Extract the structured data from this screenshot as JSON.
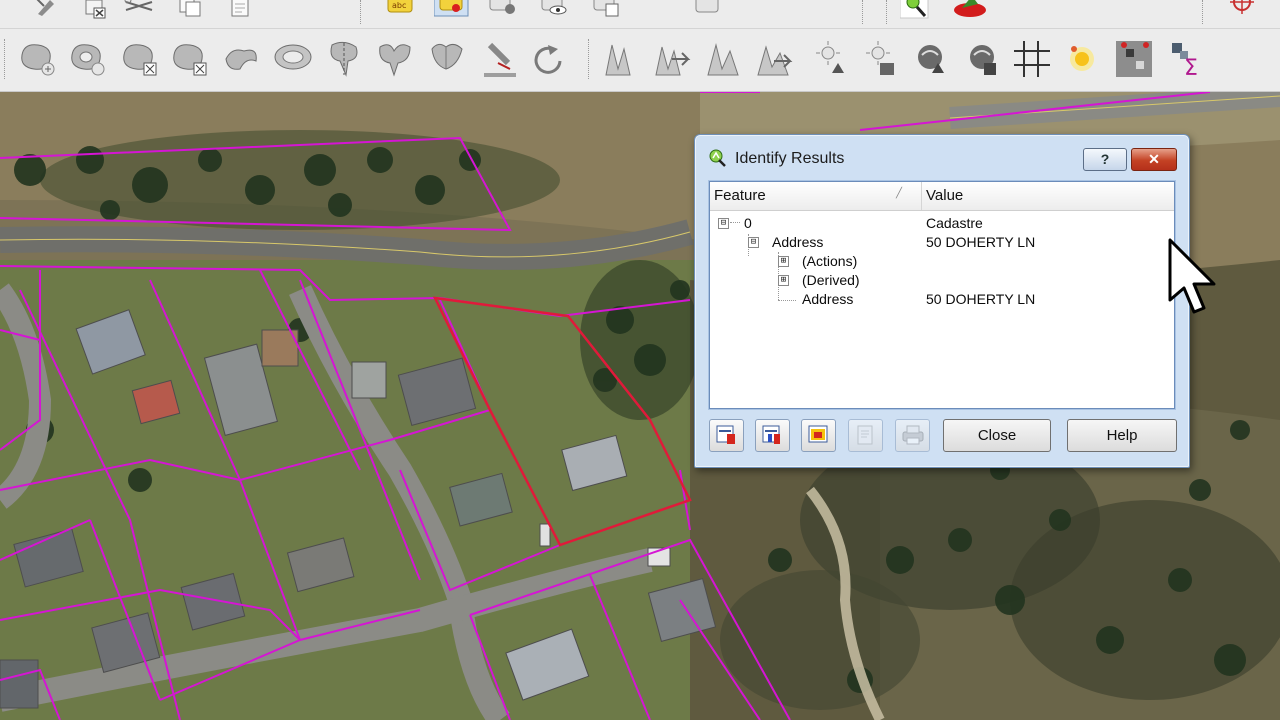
{
  "dialog": {
    "title": "Identify Results",
    "title_help_glyph": "?",
    "title_close_glyph": "✕",
    "columns": {
      "feature": "Feature",
      "value": "Value"
    },
    "rows": [
      {
        "feature": "0",
        "value": "Cadastre",
        "expander": "⊟"
      },
      {
        "feature": "Address",
        "value": "50 DOHERTY LN",
        "expander": "⊟"
      },
      {
        "feature": "(Actions)",
        "value": "",
        "expander": "⊞"
      },
      {
        "feature": "(Derived)",
        "value": "",
        "expander": "⊞"
      },
      {
        "feature": "Address",
        "value": "50 DOHERTY LN",
        "expander": ""
      }
    ],
    "buttons": {
      "close": "Close",
      "help": "Help"
    },
    "icons": [
      "expand-new-feature-icon",
      "expand-all-icon",
      "copy-attributes-icon",
      "copy-icon",
      "print-icon"
    ]
  },
  "toolbar": {
    "top_icons": [
      "edit-pencil-icon",
      "delete-selected-icon",
      "cut-icon",
      "copy-feature-icon",
      "paste-feature-icon",
      "label-tool-icon",
      "pin-label-icon",
      "show-hide-label-icon",
      "move-label-icon",
      "rotate-label-icon",
      "change-label-icon",
      "identify-icon",
      "python-plugin-icon",
      "crosshair-icon"
    ],
    "advanced_edit_icons": [
      "add-ring-icon",
      "add-part-icon",
      "delete-ring-icon",
      "delete-part-icon",
      "reshape-icon",
      "offset-curve-icon",
      "split-features-icon",
      "split-parts-icon",
      "merge-features-icon",
      "merge-attributes-icon",
      "node-tool-icon",
      "rotate-point-icon",
      "simplify-icon",
      "measure-icon",
      "measure-area-icon",
      "measure-angle-icon",
      "interpolate-icon",
      "raster-calc-icon",
      "map-tips-icon",
      "gps-icon",
      "annotation-icon",
      "form-annotation-icon",
      "grid-icon",
      "highlight-icon",
      "statistics-icon",
      "sum-icon"
    ]
  },
  "colors": {
    "parcel_outline": "#d515d4",
    "selected_parcel": "#e01a3a",
    "dialog_frame": "#cfe0f3",
    "title_close": "#c44224"
  }
}
